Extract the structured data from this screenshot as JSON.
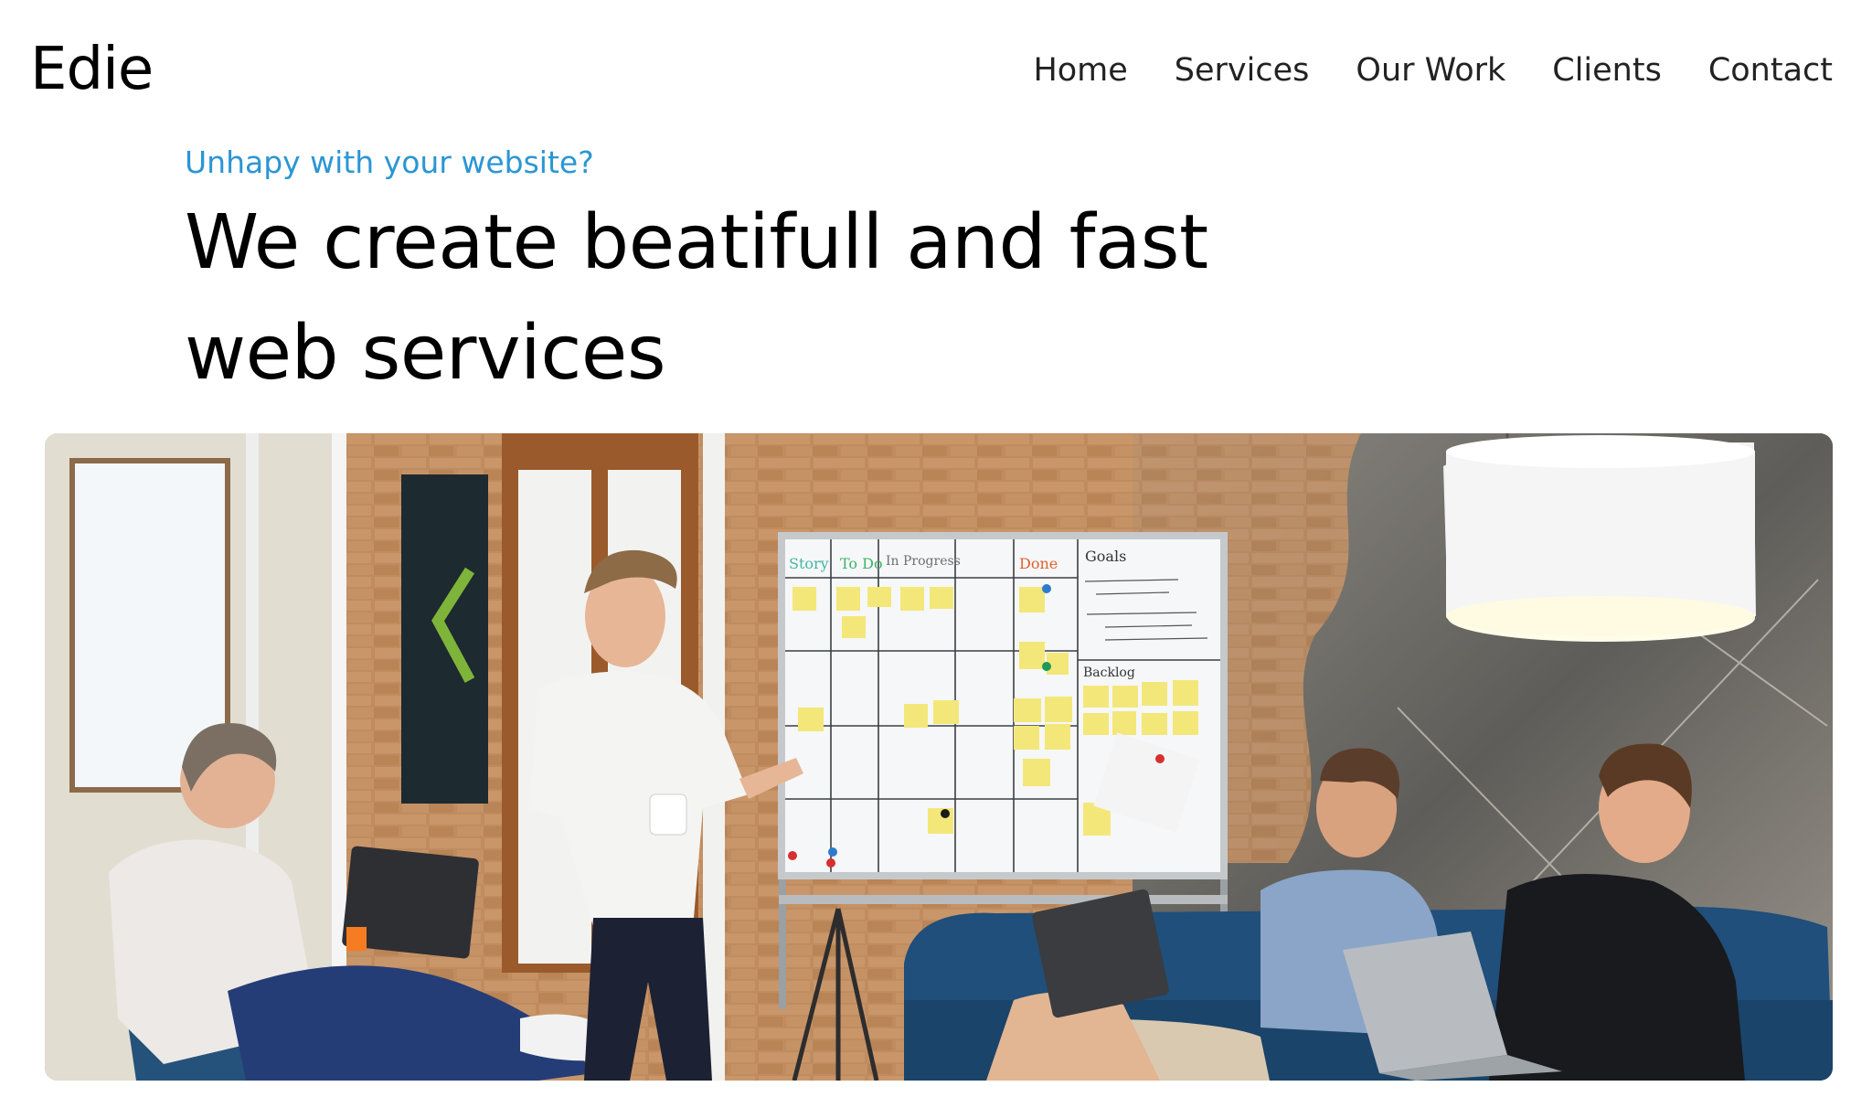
{
  "header": {
    "logo": "Edie",
    "nav": [
      {
        "label": "Home"
      },
      {
        "label": "Services"
      },
      {
        "label": "Our Work"
      },
      {
        "label": "Clients"
      },
      {
        "label": "Contact"
      }
    ]
  },
  "hero": {
    "eyebrow": "Unhapy with your website?",
    "headline_line1": "We create beatifull and fast",
    "headline_line2": "web services"
  },
  "hero_image": {
    "board_columns": [
      "Story",
      "To Do",
      "In Progress",
      "Done",
      "Goals"
    ],
    "board_backlog_label": "Backlog",
    "colors": {
      "accent": "#2b96d4",
      "brick": "#b8855a",
      "sofa": "#1f4f7a",
      "sticky": "#f3e77a"
    }
  }
}
